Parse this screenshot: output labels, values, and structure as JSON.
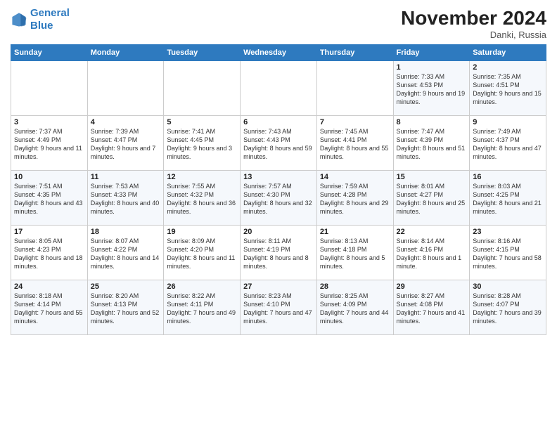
{
  "logo": {
    "line1": "General",
    "line2": "Blue"
  },
  "title": "November 2024",
  "location": "Danki, Russia",
  "days_of_week": [
    "Sunday",
    "Monday",
    "Tuesday",
    "Wednesday",
    "Thursday",
    "Friday",
    "Saturday"
  ],
  "weeks": [
    [
      {
        "day": "",
        "info": ""
      },
      {
        "day": "",
        "info": ""
      },
      {
        "day": "",
        "info": ""
      },
      {
        "day": "",
        "info": ""
      },
      {
        "day": "",
        "info": ""
      },
      {
        "day": "1",
        "info": "Sunrise: 7:33 AM\nSunset: 4:53 PM\nDaylight: 9 hours and 19 minutes."
      },
      {
        "day": "2",
        "info": "Sunrise: 7:35 AM\nSunset: 4:51 PM\nDaylight: 9 hours and 15 minutes."
      }
    ],
    [
      {
        "day": "3",
        "info": "Sunrise: 7:37 AM\nSunset: 4:49 PM\nDaylight: 9 hours and 11 minutes."
      },
      {
        "day": "4",
        "info": "Sunrise: 7:39 AM\nSunset: 4:47 PM\nDaylight: 9 hours and 7 minutes."
      },
      {
        "day": "5",
        "info": "Sunrise: 7:41 AM\nSunset: 4:45 PM\nDaylight: 9 hours and 3 minutes."
      },
      {
        "day": "6",
        "info": "Sunrise: 7:43 AM\nSunset: 4:43 PM\nDaylight: 8 hours and 59 minutes."
      },
      {
        "day": "7",
        "info": "Sunrise: 7:45 AM\nSunset: 4:41 PM\nDaylight: 8 hours and 55 minutes."
      },
      {
        "day": "8",
        "info": "Sunrise: 7:47 AM\nSunset: 4:39 PM\nDaylight: 8 hours and 51 minutes."
      },
      {
        "day": "9",
        "info": "Sunrise: 7:49 AM\nSunset: 4:37 PM\nDaylight: 8 hours and 47 minutes."
      }
    ],
    [
      {
        "day": "10",
        "info": "Sunrise: 7:51 AM\nSunset: 4:35 PM\nDaylight: 8 hours and 43 minutes."
      },
      {
        "day": "11",
        "info": "Sunrise: 7:53 AM\nSunset: 4:33 PM\nDaylight: 8 hours and 40 minutes."
      },
      {
        "day": "12",
        "info": "Sunrise: 7:55 AM\nSunset: 4:32 PM\nDaylight: 8 hours and 36 minutes."
      },
      {
        "day": "13",
        "info": "Sunrise: 7:57 AM\nSunset: 4:30 PM\nDaylight: 8 hours and 32 minutes."
      },
      {
        "day": "14",
        "info": "Sunrise: 7:59 AM\nSunset: 4:28 PM\nDaylight: 8 hours and 29 minutes."
      },
      {
        "day": "15",
        "info": "Sunrise: 8:01 AM\nSunset: 4:27 PM\nDaylight: 8 hours and 25 minutes."
      },
      {
        "day": "16",
        "info": "Sunrise: 8:03 AM\nSunset: 4:25 PM\nDaylight: 8 hours and 21 minutes."
      }
    ],
    [
      {
        "day": "17",
        "info": "Sunrise: 8:05 AM\nSunset: 4:23 PM\nDaylight: 8 hours and 18 minutes."
      },
      {
        "day": "18",
        "info": "Sunrise: 8:07 AM\nSunset: 4:22 PM\nDaylight: 8 hours and 14 minutes."
      },
      {
        "day": "19",
        "info": "Sunrise: 8:09 AM\nSunset: 4:20 PM\nDaylight: 8 hours and 11 minutes."
      },
      {
        "day": "20",
        "info": "Sunrise: 8:11 AM\nSunset: 4:19 PM\nDaylight: 8 hours and 8 minutes."
      },
      {
        "day": "21",
        "info": "Sunrise: 8:13 AM\nSunset: 4:18 PM\nDaylight: 8 hours and 5 minutes."
      },
      {
        "day": "22",
        "info": "Sunrise: 8:14 AM\nSunset: 4:16 PM\nDaylight: 8 hours and 1 minute."
      },
      {
        "day": "23",
        "info": "Sunrise: 8:16 AM\nSunset: 4:15 PM\nDaylight: 7 hours and 58 minutes."
      }
    ],
    [
      {
        "day": "24",
        "info": "Sunrise: 8:18 AM\nSunset: 4:14 PM\nDaylight: 7 hours and 55 minutes."
      },
      {
        "day": "25",
        "info": "Sunrise: 8:20 AM\nSunset: 4:13 PM\nDaylight: 7 hours and 52 minutes."
      },
      {
        "day": "26",
        "info": "Sunrise: 8:22 AM\nSunset: 4:11 PM\nDaylight: 7 hours and 49 minutes."
      },
      {
        "day": "27",
        "info": "Sunrise: 8:23 AM\nSunset: 4:10 PM\nDaylight: 7 hours and 47 minutes."
      },
      {
        "day": "28",
        "info": "Sunrise: 8:25 AM\nSunset: 4:09 PM\nDaylight: 7 hours and 44 minutes."
      },
      {
        "day": "29",
        "info": "Sunrise: 8:27 AM\nSunset: 4:08 PM\nDaylight: 7 hours and 41 minutes."
      },
      {
        "day": "30",
        "info": "Sunrise: 8:28 AM\nSunset: 4:07 PM\nDaylight: 7 hours and 39 minutes."
      }
    ]
  ]
}
